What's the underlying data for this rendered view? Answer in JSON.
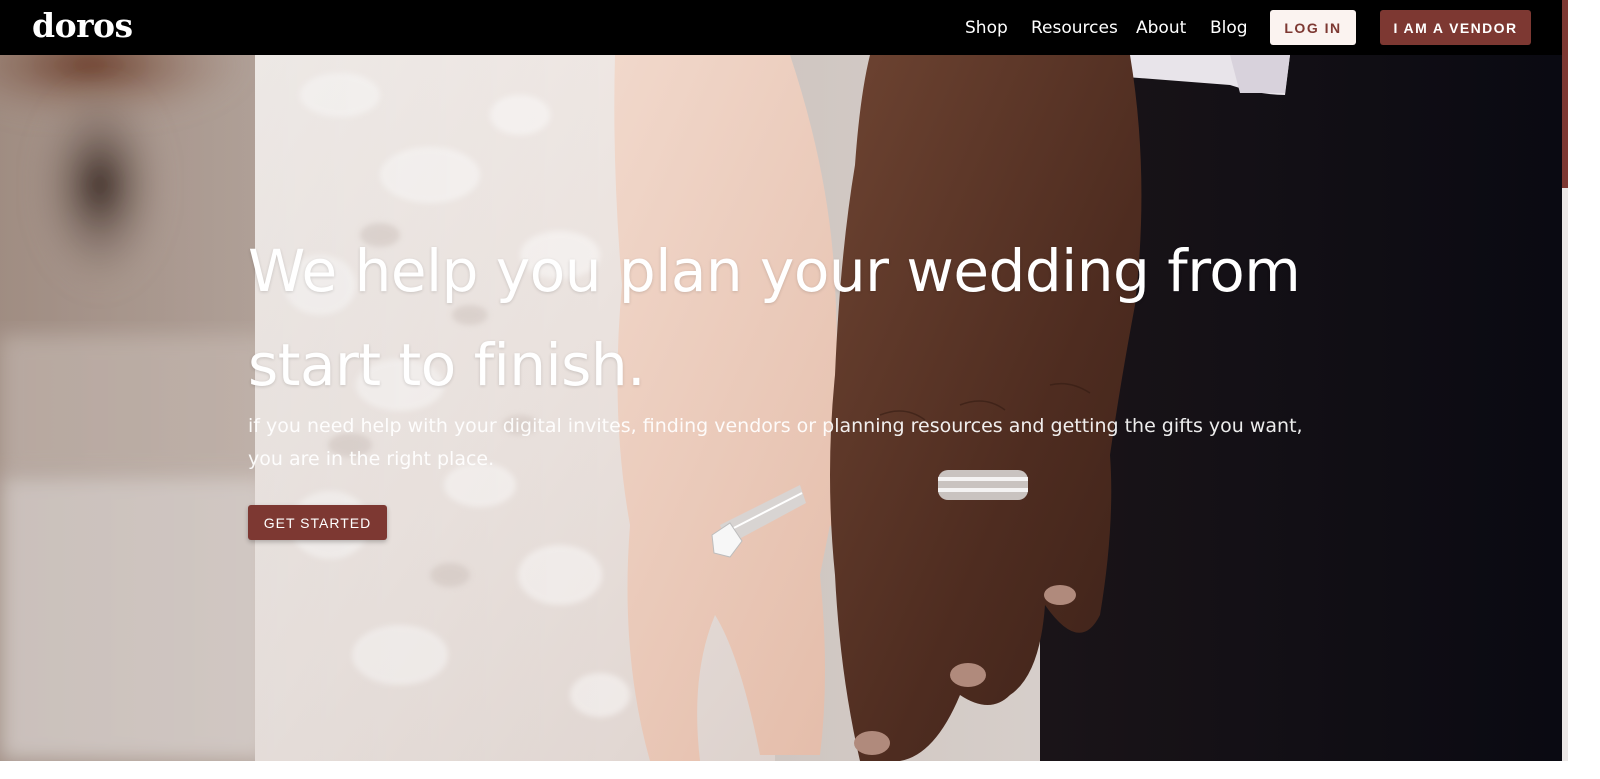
{
  "brand": {
    "logo_text": "doros"
  },
  "nav": {
    "links": [
      {
        "label": "Shop"
      },
      {
        "label": "Resources"
      },
      {
        "label": "About"
      },
      {
        "label": "Blog"
      }
    ],
    "login_label": "LOG IN",
    "vendor_label": "I AM A VENDOR"
  },
  "hero": {
    "title_line1": "We help you plan your wedding from",
    "title_line2": "start to finish.",
    "subtitle_line1": "if you need help with your digital invites, finding vendors or planning resources and getting the gifts you want,",
    "subtitle_line2": "you are in the right place.",
    "cta_label": "GET STARTED",
    "image_description_icon": "wedding-hands-photo"
  },
  "colors": {
    "brand": "#7d3832",
    "nav_background": "#000000",
    "login_background": "#fbf3f0",
    "text_light": "#ffffff"
  },
  "scroll": {
    "position_fraction": 0.0
  }
}
